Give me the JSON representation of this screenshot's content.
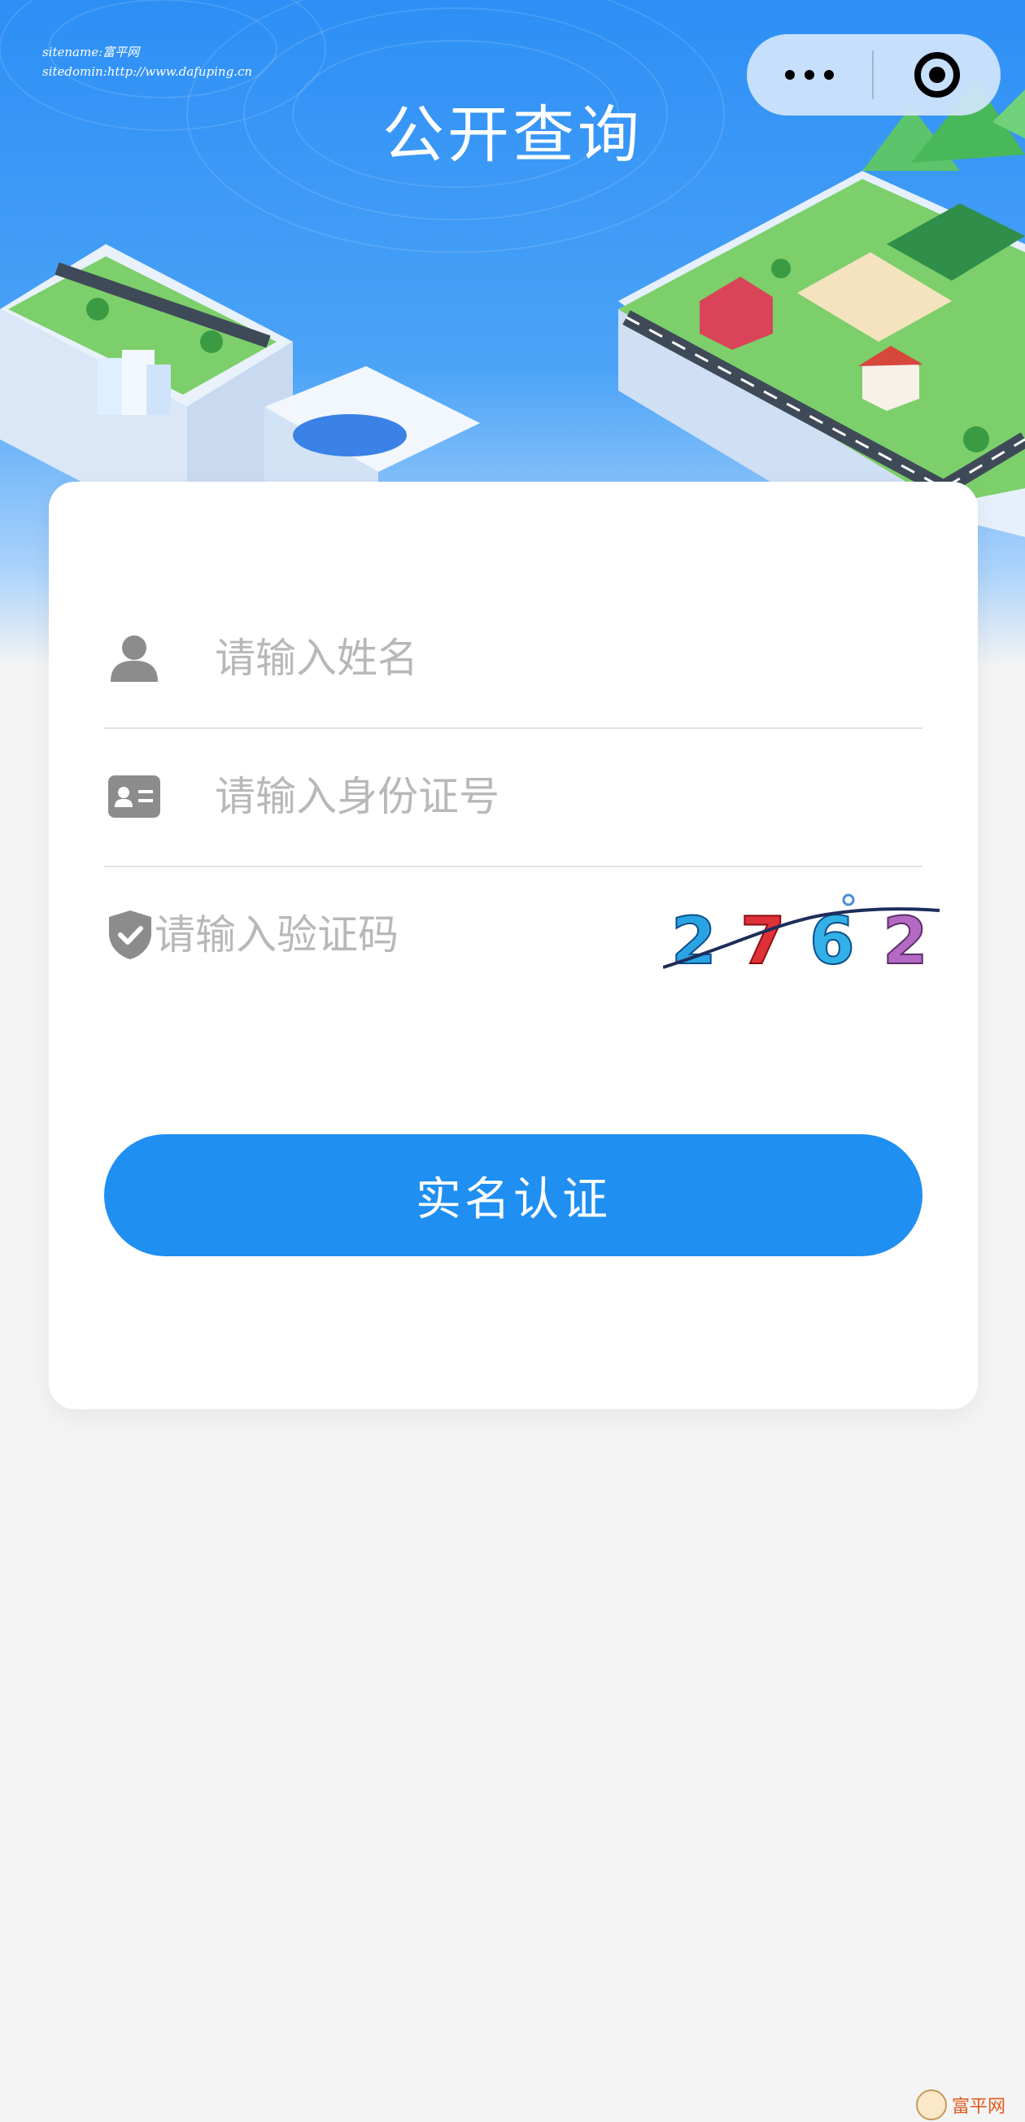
{
  "header": {
    "title": "公开查询",
    "watermark_lines": [
      "sitename:富平网",
      "sitedomin:http://www.dafuping.cn"
    ]
  },
  "capsule": {
    "more_icon": "more-dots-icon",
    "close_icon": "target-close-icon"
  },
  "form": {
    "name_placeholder": "请输入姓名",
    "id_placeholder": "请输入身份证号",
    "code_placeholder": "请输入验证码",
    "captcha_text": "2762",
    "submit_label": "实名认证"
  },
  "footer": {
    "logo_text": "富平网"
  },
  "colors": {
    "primary": "#1f8ff2",
    "hero_top": "#2d8ff5",
    "background": "#f4f4f4"
  }
}
